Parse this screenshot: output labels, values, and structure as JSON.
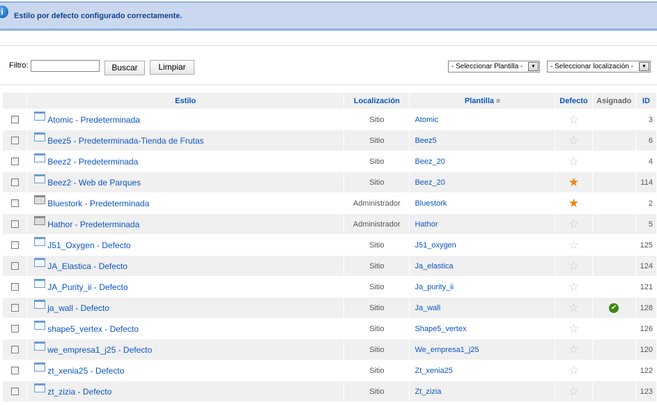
{
  "message": {
    "icon": "info-icon",
    "text": "Estilo por defecto configurado correctamente."
  },
  "filter": {
    "label": "Filtro:",
    "value": "",
    "search_button": "Buscar",
    "clear_button": "Limpiar",
    "template_select": "- Seleccionar Plantilla -",
    "location_select": "- Seleccionar localización -"
  },
  "columns": {
    "style": "Estilo",
    "location": "Localización",
    "template": "Plantilla",
    "default": "Defecto",
    "assigned": "Asignado",
    "id": "ID"
  },
  "rows": [
    {
      "name": "Atomic - Predeterminada",
      "location": "Sitio",
      "template": "Atomic",
      "default": false,
      "assigned": false,
      "id": "3"
    },
    {
      "name": "Beez5 - Predeterminada-Tienda de Frutas",
      "location": "Sitio",
      "template": "Beez5",
      "default": false,
      "assigned": false,
      "id": "6"
    },
    {
      "name": "Beez2 - Predeterminada",
      "location": "Sitio",
      "template": "Beez_20",
      "default": false,
      "assigned": false,
      "id": "4"
    },
    {
      "name": "Beez2 - Web de Parques",
      "location": "Sitio",
      "template": "Beez_20",
      "default": true,
      "assigned": false,
      "id": "114"
    },
    {
      "name": "Bluestork - Predeterminada",
      "location": "Administrador",
      "template": "Bluestork",
      "default": true,
      "assigned": false,
      "id": "2"
    },
    {
      "name": "Hathor - Predeterminada",
      "location": "Administrador",
      "template": "Hathor",
      "default": false,
      "assigned": false,
      "id": "5"
    },
    {
      "name": "J51_Oxygen - Defecto",
      "location": "Sitio",
      "template": "J51_oxygen",
      "default": false,
      "assigned": false,
      "id": "125"
    },
    {
      "name": "JA_Elastica - Defecto",
      "location": "Sitio",
      "template": "Ja_elastica",
      "default": false,
      "assigned": false,
      "id": "124"
    },
    {
      "name": "JA_Purity_ii - Defecto",
      "location": "Sitio",
      "template": "Ja_purity_ii",
      "default": false,
      "assigned": false,
      "id": "121"
    },
    {
      "name": "ja_wall - Defecto",
      "location": "Sitio",
      "template": "Ja_wall",
      "default": false,
      "assigned": true,
      "id": "128"
    },
    {
      "name": "shape5_vertex - Defecto",
      "location": "Sitio",
      "template": "Shape5_vertex",
      "default": false,
      "assigned": false,
      "id": "126"
    },
    {
      "name": "we_empresa1_j25 - Defecto",
      "location": "Sitio",
      "template": "We_empresa1_j25",
      "default": false,
      "assigned": false,
      "id": "120"
    },
    {
      "name": "zt_xenia25 - Defecto",
      "location": "Sitio",
      "template": "Zt_xenia25",
      "default": false,
      "assigned": false,
      "id": "122"
    },
    {
      "name": "zt_zizia - Defecto",
      "location": "Sitio",
      "template": "Zt_zizia",
      "default": false,
      "assigned": false,
      "id": "123"
    }
  ]
}
